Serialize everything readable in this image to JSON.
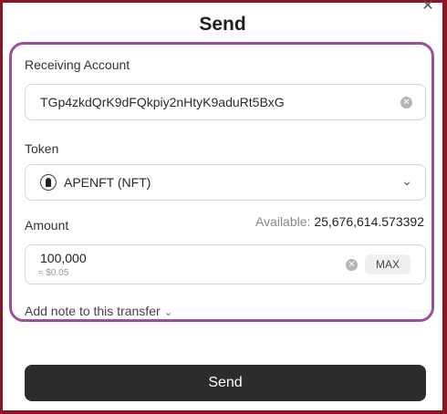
{
  "dialog": {
    "title": "Send",
    "close_icon": "close-icon"
  },
  "receiving": {
    "label": "Receiving Account",
    "value": "TGp4zkdQrK9dFQkpiy2nHtyK9aduRt5BxG"
  },
  "token": {
    "label": "Token",
    "value": "APENFT (NFT)",
    "icon": "apenft-token-icon"
  },
  "amount": {
    "label": "Amount",
    "available_label": "Available:",
    "available_value": "25,676,614.573392",
    "value": "100,000",
    "usd": "≈ $0.05",
    "max_label": "MAX"
  },
  "note": {
    "label": "Add note to this transfer"
  },
  "footer": {
    "send_label": "Send"
  },
  "colors": {
    "frame": "#8c1423",
    "panel_border": "#9c4f9e",
    "button": "#2c2c2c"
  }
}
